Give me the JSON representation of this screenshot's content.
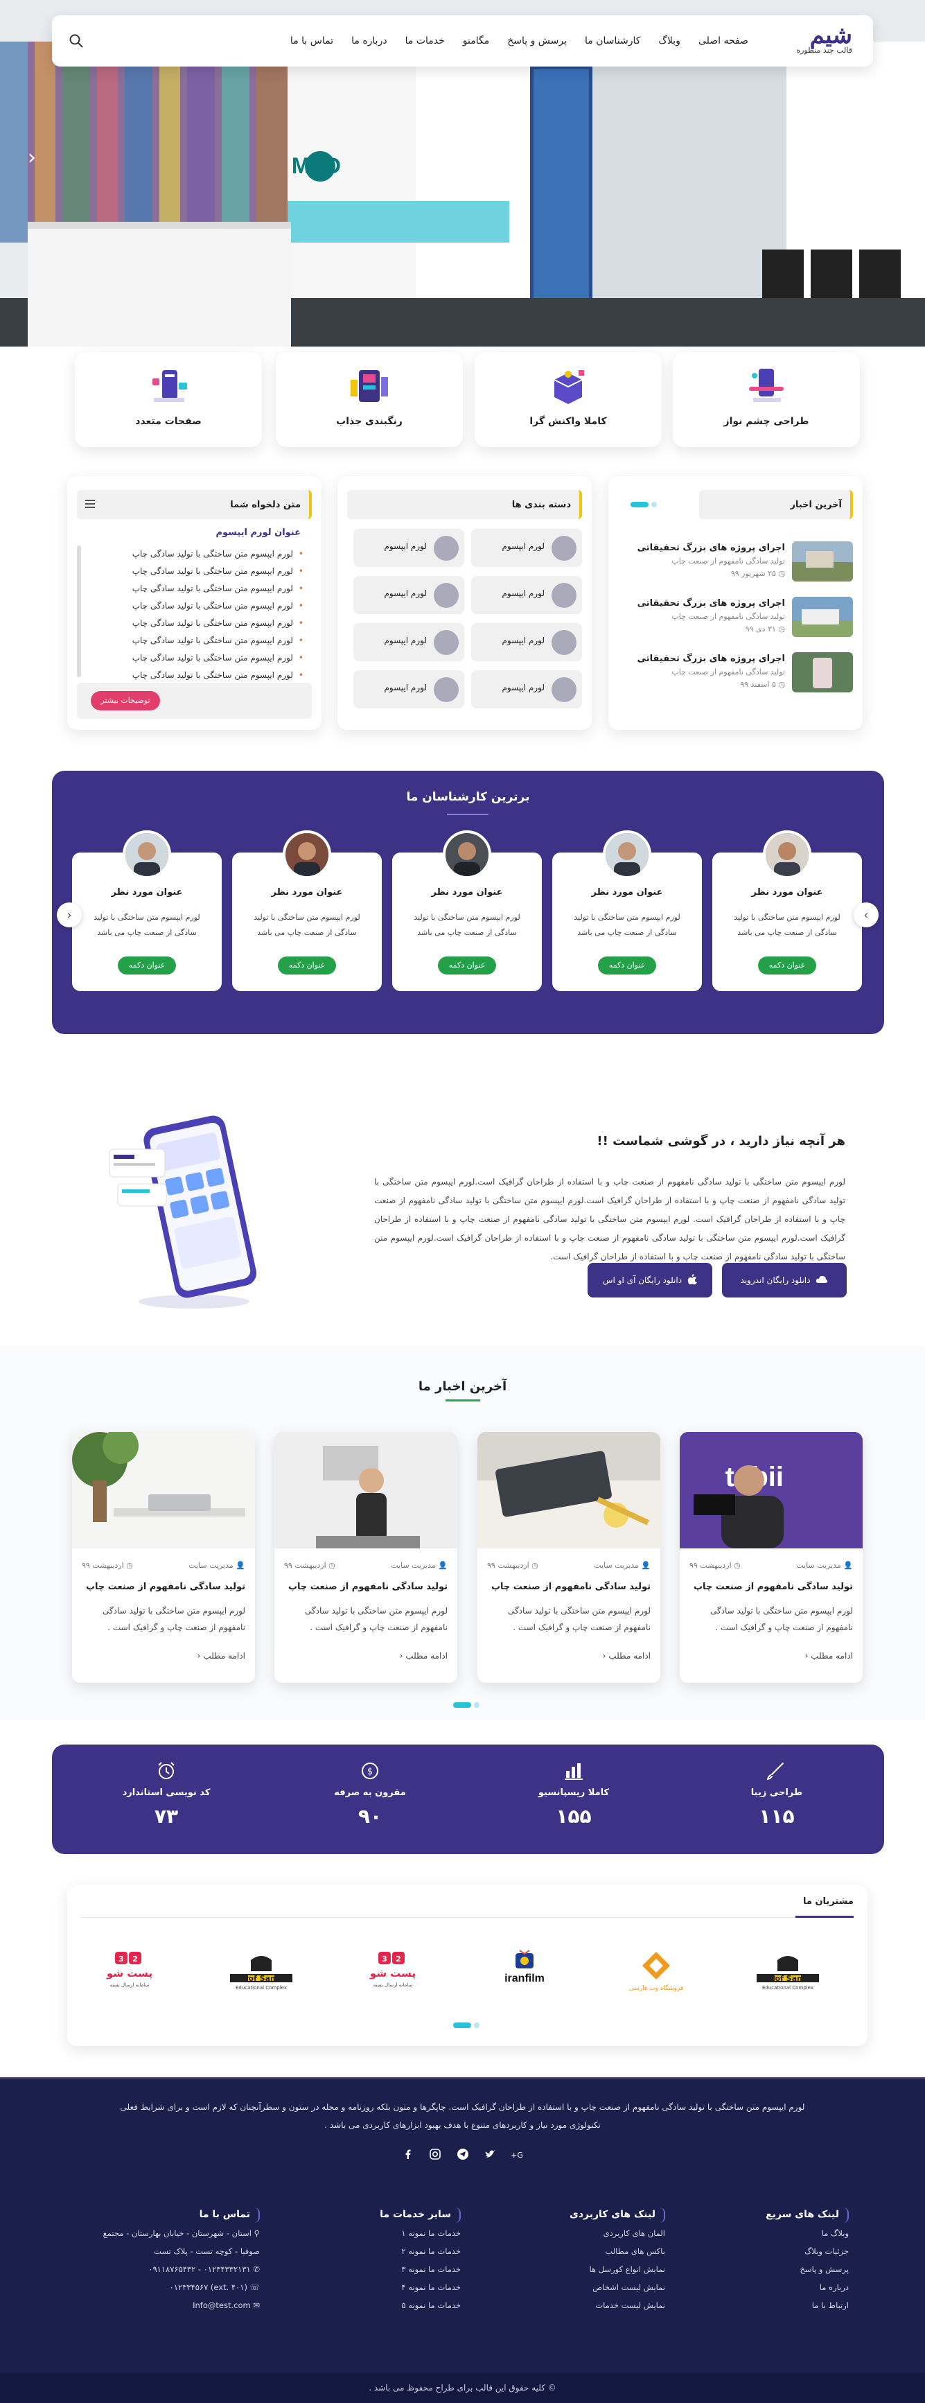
{
  "header": {
    "logo_text": "شیم",
    "logo_sub": "قالب چند منظوره",
    "nav": [
      "صفحه اصلی",
      "وبلاگ",
      "کارشناسان ما",
      "پرسش و پاسخ",
      "مگامنو",
      "خدمات ما",
      "درباره ما",
      "تماس با ما"
    ]
  },
  "hero": {
    "prev": "‹",
    "next": "›"
  },
  "features": [
    {
      "label": "طراحی چشم نواز"
    },
    {
      "label": "کاملا واکنش گرا"
    },
    {
      "label": "رنگبندی جذاب"
    },
    {
      "label": "صفحات متعدد"
    }
  ],
  "latest_news_widget": {
    "title": "آخرین اخبار",
    "items": [
      {
        "title": "اجرای پروژه های بزرگ تحقیقاتی",
        "sub": "تولید سادگی نامفهوم از صنعت چاپ",
        "date": "۲۵ شهریور ۹۹"
      },
      {
        "title": "اجرای پروژه های بزرگ تحقیقاتی",
        "sub": "تولید سادگی نامفهوم از صنعت چاپ",
        "date": "۳۱ دی ۹۹"
      },
      {
        "title": "اجرای پروژه های بزرگ تحقیقاتی",
        "sub": "تولید سادگی نامفهوم از صنعت چاپ",
        "date": "۵ اسفند ۹۹"
      }
    ]
  },
  "categories_widget": {
    "title": "دسته بندی ها",
    "items": [
      "لورم ایپسوم",
      "لورم ایپسوم",
      "لورم ایپسوم",
      "لورم ایپسوم",
      "لورم ایپسوم",
      "لورم ایپسوم",
      "لورم ایپسوم",
      "لورم ایپسوم"
    ]
  },
  "custom_text_widget": {
    "title": "متن دلخواه شما",
    "heading": "عنوان لورم ایپسوم",
    "lines": [
      "لورم ایپسوم متن ساختگی با تولید سادگی چاپ",
      "لورم ایپسوم متن ساختگی با تولید سادگی چاپ",
      "لورم ایپسوم متن ساختگی با تولید سادگی چاپ",
      "لورم ایپسوم متن ساختگی با تولید سادگی چاپ",
      "لورم ایپسوم متن ساختگی با تولید سادگی چاپ",
      "لورم ایپسوم متن ساختگی با تولید سادگی چاپ",
      "لورم ایپسوم متن ساختگی با تولید سادگی چاپ",
      "لورم ایپسوم متن ساختگی با تولید سادگی چاپ"
    ],
    "button": "توضیحات بیشتر"
  },
  "experts": {
    "title": "برترین کارشناسان ما",
    "cards": [
      {
        "name": "عنوان مورد نظر",
        "desc": "لورم ایپسوم متن ساختگی با تولید سادگی از صنعت چاپ می باشد",
        "button": "عنوان دکمه"
      },
      {
        "name": "عنوان مورد نظر",
        "desc": "لورم ایپسوم متن ساختگی با تولید سادگی از صنعت چاپ می باشد",
        "button": "عنوان دکمه"
      },
      {
        "name": "عنوان مورد نظر",
        "desc": "لورم ایپسوم متن ساختگی با تولید سادگی از صنعت چاپ می باشد",
        "button": "عنوان دکمه"
      },
      {
        "name": "عنوان مورد نظر",
        "desc": "لورم ایپسوم متن ساختگی با تولید سادگی از صنعت چاپ می باشد",
        "button": "عنوان دکمه"
      },
      {
        "name": "عنوان مورد نظر",
        "desc": "لورم ایپسوم متن ساختگی با تولید سادگی از صنعت چاپ می باشد",
        "button": "عنوان دکمه"
      }
    ]
  },
  "app": {
    "title": "هر آنچه نیاز دارید ، در گوشی شماست !!",
    "text": "لورم ایپسوم متن ساختگی با تولید سادگی نامفهوم از صنعت چاپ و با استفاده از طراحان گرافیک است.لورم ایپسوم متن ساختگی با تولید سادگی نامفهوم از صنعت چاپ و با استفاده از طراحان گرافیک است.لورم ایپسوم متن ساختگی با تولید سادگی نامفهوم از صنعت چاپ و با استفاده از طراحان گرافیک است. لورم ایپسوم متن ساختگی با تولید سادگی نامفهوم از صنعت چاپ و با استفاده از طراحان گرافیک است.لورم ایپسوم متن ساختگی با تولید سادگی نامفهوم از صنعت چاپ و با استفاده از طراحان گرافیک است.لورم ایپسوم متن ساختگی با تولید سادگی نامفهوم از صنعت چاپ و با استفاده از طراحان گرافیک است.",
    "android_button": "دانلود رایگان اندروید",
    "ios_button": "دانلود رایگان آی او اس"
  },
  "news": {
    "title": "آخرین اخبار ما",
    "cards": [
      {
        "author": "مدیریت سایت",
        "date": "اردیبهشت ۹۹",
        "title": "تولید سادگی نامفهوم از صنعت چاپ",
        "excerpt": "لورم ایپسوم متن ساختگی با تولید سادگی نامفهوم از صنعت چاپ و گرافیک است .",
        "more": "ادامه مطلب"
      },
      {
        "author": "مدیریت سایت",
        "date": "اردیبهشت ۹۹",
        "title": "تولید سادگی نامفهوم از صنعت چاپ",
        "excerpt": "لورم ایپسوم متن ساختگی با تولید سادگی نامفهوم از صنعت چاپ و گرافیک است .",
        "more": "ادامه مطلب"
      },
      {
        "author": "مدیریت سایت",
        "date": "اردیبهشت ۹۹",
        "title": "تولید سادگی نامفهوم از صنعت چاپ",
        "excerpt": "لورم ایپسوم متن ساختگی با تولید سادگی نامفهوم از صنعت چاپ و گرافیک است .",
        "more": "ادامه مطلب"
      },
      {
        "author": "مدیریت سایت",
        "date": "اردیبهشت ۹۹",
        "title": "تولید سادگی نامفهوم از صنعت چاپ",
        "excerpt": "لورم ایپسوم متن ساختگی با تولید سادگی نامفهوم از صنعت چاپ و گرافیک است .",
        "more": "ادامه مطلب"
      }
    ]
  },
  "stats": [
    {
      "label": "طراحی زیبا",
      "value": "۱۱۵"
    },
    {
      "label": "کاملا ریسپانسیو",
      "value": "۱۵۵"
    },
    {
      "label": "مقرون به صرفه",
      "value": "۹۰"
    },
    {
      "label": "کد نویسی استاندارد",
      "value": "۷۳"
    }
  ],
  "customers": {
    "title": "مشتریان ما",
    "logos": [
      "Prof Samii",
      "فروشگاه وب فارسی",
      "iranfilm",
      "پست شو",
      "Prof Samii",
      "پست شو"
    ],
    "logo_subs": [
      "Educational Complex",
      "",
      "",
      "سامانه ارسال بسته",
      "Educational Complex",
      "سامانه ارسال بسته"
    ]
  },
  "footer": {
    "text": "لورم ایپسوم متن ساختگی با تولید سادگی نامفهوم از صنعت چاپ و با استفاده از طراحان گرافیک است. چاپگرها و متون بلکه روزنامه و مجله در ستون و سطرآنچنان که لازم است و برای شرایط فعلی تکنولوژی مورد نیاز و کاربردهای متنوع با هدف بهبود ابزارهای کاربردی می باشد .",
    "social": [
      "google-plus-icon",
      "twitter-icon",
      "telegram-icon",
      "instagram-icon",
      "facebook-icon"
    ],
    "col_quick": {
      "title": "لینک های سریع",
      "items": [
        "وبلاگ ما",
        "جزئیات وبلاگ",
        "پرسش و پاسخ",
        "درباره ما",
        "ارتباط با ما"
      ]
    },
    "col_useful": {
      "title": "لینک های کاربردی",
      "items": [
        "المان های کاربردی",
        "باکس های مطالب",
        "نمایش انواع کورسل ها",
        "نمایش لیست اشخاص",
        "نمایش لیست خدمات"
      ]
    },
    "col_services": {
      "title": "سایر خدمات ما",
      "items": [
        "خدمات ما نمونه ۱",
        "خدمات ما نمونه ۲",
        "خدمات ما نمونه ۳",
        "خدمات ما نمونه ۴",
        "خدمات ما نمونه ۵"
      ]
    },
    "col_contact": {
      "title": "تماس با ما",
      "address_1": "استان - شهرستان - خیابان بهارستان - مجتمع",
      "address_2": "صوفیا - کوچه تست - پلاک تست",
      "phone_1": "۰۱۲۳۴۳۳۲۱۳۱ - ۰۹۱۱۸۷۶۵۴۳۲",
      "phone_2": "(ext. ۴۰۱) ۰۱۲۳۳۴۵۶۷",
      "email": "Info@test.com"
    },
    "copyright": "© کلیه حقوق این قالب برای طراح محفوظ می باشد ."
  },
  "colors": {
    "primary": "#3d3285",
    "accent_green": "#24a148",
    "accent_teal": "#27c3d8",
    "accent_yellow": "#f1c40f",
    "footer_bg": "#1a1f4b"
  }
}
